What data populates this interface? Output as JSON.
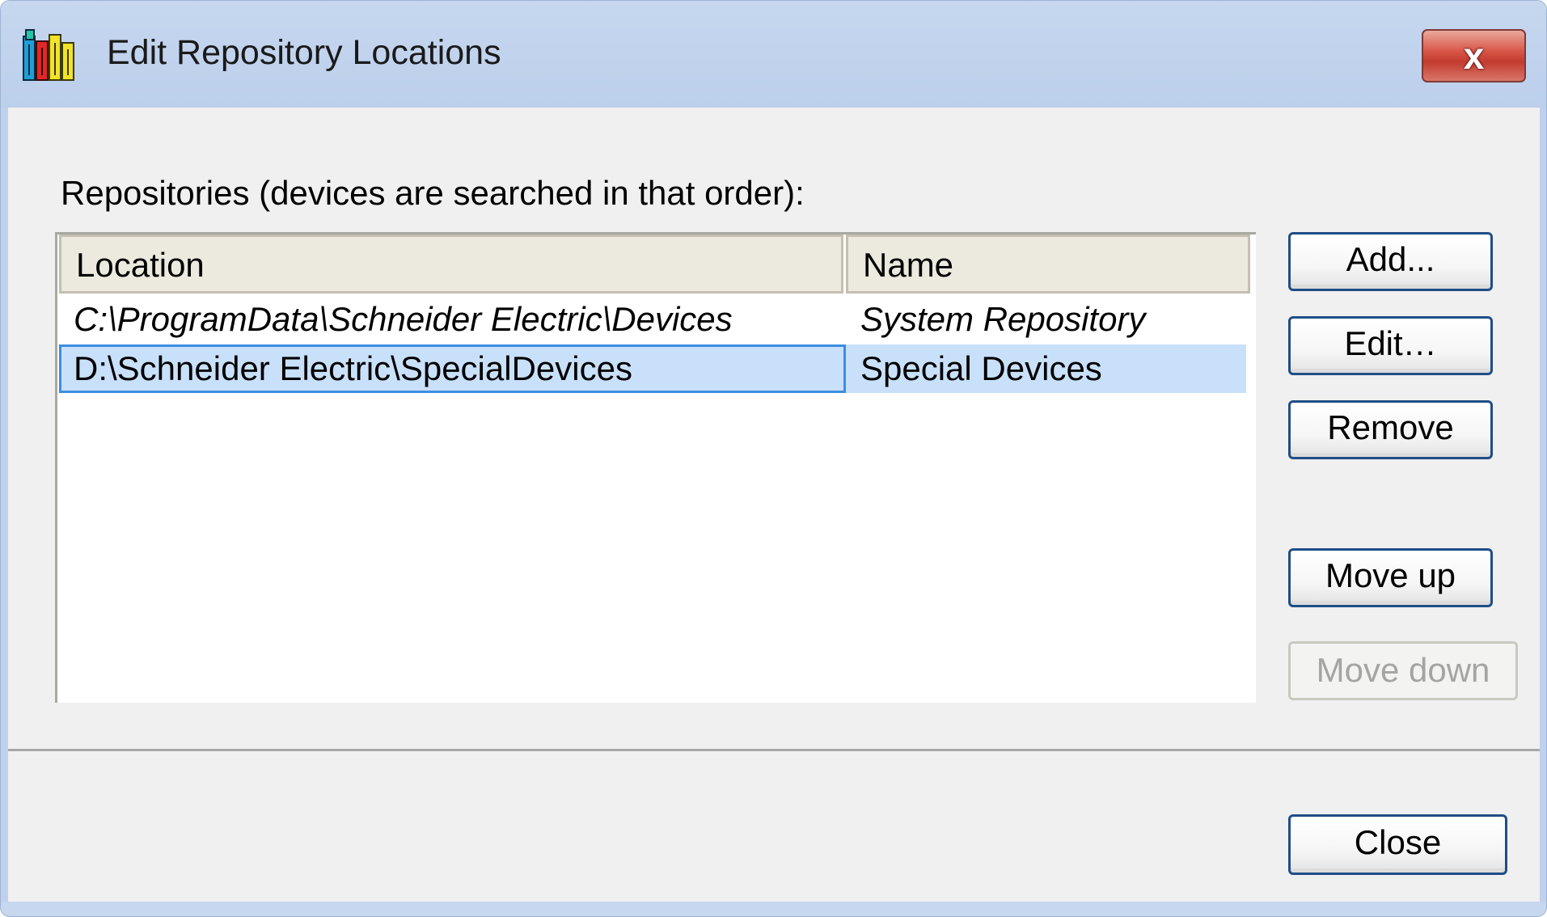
{
  "window": {
    "title": "Edit Repository Locations",
    "icon": "repository-books-icon",
    "close_glyph": "x"
  },
  "dialog": {
    "label": "Repositories (devices are searched in that order):",
    "table": {
      "columns": [
        "Location",
        "Name"
      ],
      "rows": [
        {
          "location": "C:\\ProgramData\\Schneider Electric\\Devices",
          "name": "System Repository",
          "italic": true,
          "selected": false
        },
        {
          "location": "D:\\Schneider Electric\\SpecialDevices",
          "name": "Special Devices",
          "italic": false,
          "selected": true
        }
      ]
    },
    "buttons": {
      "add": "Add...",
      "edit": "Edit…",
      "remove": "Remove",
      "move_up": "Move up",
      "move_down": "Move down",
      "close": "Close"
    },
    "button_states": {
      "move_down_enabled": false
    }
  },
  "colors": {
    "title_bar": "#bfd1ec",
    "selection": "#c9e0fa",
    "selection_border": "#3b8ee0",
    "button_border": "#1f4e86",
    "close_button": "#c23b2e"
  }
}
